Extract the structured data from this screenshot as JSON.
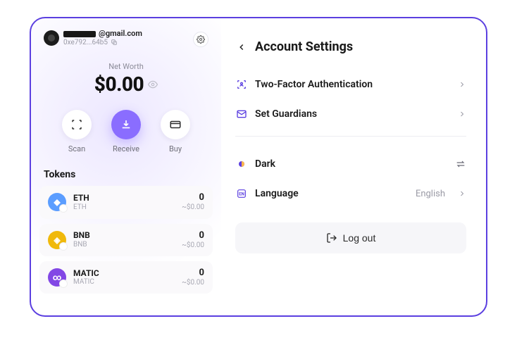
{
  "user": {
    "email_suffix": "@gmail.com",
    "address": "0xe792...64b5"
  },
  "wallet": {
    "net_worth_label": "Net Worth",
    "net_worth_value": "$0.00",
    "actions": {
      "scan": "Scan",
      "receive": "Receive",
      "buy": "Buy"
    }
  },
  "tokens_header": "Tokens",
  "tokens": [
    {
      "symbol": "ETH",
      "sub": "ETH",
      "amount": "0",
      "fiat": "~$0.00"
    },
    {
      "symbol": "BNB",
      "sub": "BNB",
      "amount": "0",
      "fiat": "~$0.00"
    },
    {
      "symbol": "MATIC",
      "sub": "MATIC",
      "amount": "0",
      "fiat": "~$0.00"
    }
  ],
  "settings": {
    "title": "Account Settings",
    "twofa": "Two-Factor Authentication",
    "guardians": "Set Guardians",
    "dark": "Dark",
    "language_label": "Language",
    "language_value": "English",
    "logout": "Log out"
  }
}
